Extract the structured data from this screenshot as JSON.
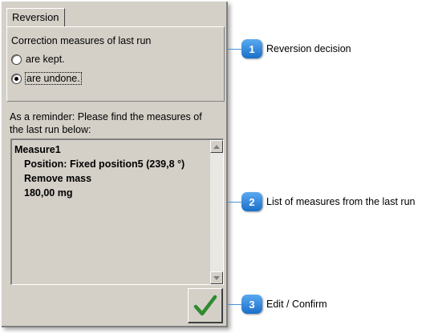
{
  "panel": {
    "tab_label": "Reversion",
    "group": {
      "title": "Correction measures of last run",
      "options": [
        {
          "label": "are kept.",
          "checked": false
        },
        {
          "label": "are undone.",
          "checked": true
        }
      ]
    },
    "reminder_line1": "As a reminder: Please find the measures of",
    "reminder_line2": "the last run below:",
    "measures": {
      "name": "Measure1",
      "position": "Position: Fixed position5 (239,8 °)",
      "action": "Remove mass",
      "amount": "180,00 mg"
    },
    "confirm_icon": "checkmark-icon"
  },
  "callouts": [
    {
      "number": "1",
      "text": "Reversion decision"
    },
    {
      "number": "2",
      "text": "List of measures from the last run"
    },
    {
      "number": "3",
      "text": "Edit / Confirm"
    }
  ],
  "colors": {
    "panel_bg": "#d4d0c8",
    "badge_blue": "#1a6fc9",
    "check_green": "#2e8b2e"
  }
}
